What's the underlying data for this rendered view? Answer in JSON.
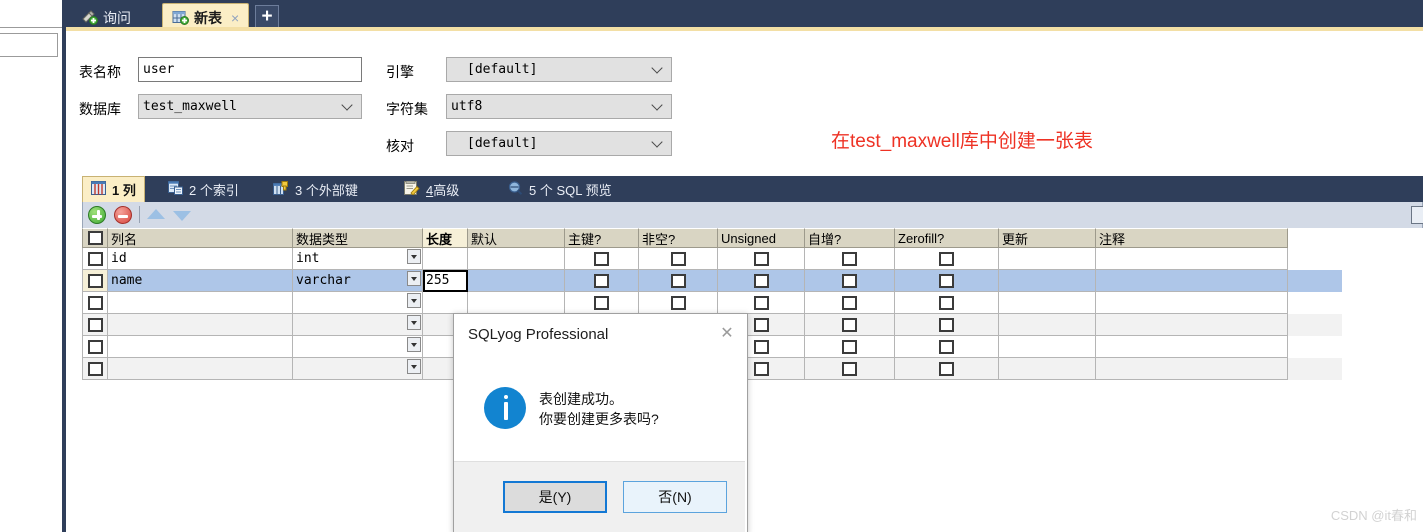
{
  "window": {
    "top_tabs": [
      {
        "label": "询问",
        "icon": "query-icon",
        "active": false,
        "closable": false
      },
      {
        "label": "新表",
        "icon": "new-table-icon",
        "active": true,
        "closable": true,
        "close_glyph": "×"
      }
    ],
    "add_tab_button": {
      "label": "+",
      "icon": "plus-icon"
    }
  },
  "form": {
    "table_name_label": "表名称",
    "table_name_value": "user",
    "database_label": "数据库",
    "database_value": "test_maxwell",
    "engine_label": "引擎",
    "engine_value": "[default]",
    "charset_label": "字符集",
    "charset_value": "utf8",
    "collation_label": "核对",
    "collation_value": "[default]"
  },
  "annotation": {
    "text": "在test_maxwell库中创建一张表",
    "color": "#ee3224"
  },
  "sub_tabs": [
    {
      "label": "1 列",
      "icon": "columns-icon",
      "active": true
    },
    {
      "label": "2 个索引",
      "icon": "index-icon",
      "active": false
    },
    {
      "label": "3 个外部键",
      "icon": "foreign-key-icon",
      "active": false
    },
    {
      "label": "4高级",
      "icon": "advanced-icon",
      "active": false,
      "underline_prefix": "4",
      "rest": "高级"
    },
    {
      "label": "5 个 SQL 预览",
      "icon": "sql-preview-icon",
      "active": false
    }
  ],
  "grid_toolbar": {
    "add_row": "add-row-icon",
    "remove_row": "remove-row-icon",
    "move_up": "move-up-icon",
    "move_down": "move-down-icon"
  },
  "grid": {
    "headers": [
      "",
      "列名",
      "数据类型",
      "长度",
      "默认",
      "主键?",
      "非空?",
      "Unsigned",
      "自增?",
      "Zerofill?",
      "更新",
      "注释"
    ],
    "highlighted_header": "长度",
    "rows": [
      {
        "selected": false,
        "alt": false,
        "name": "id",
        "type": "int",
        "length": "",
        "default": "",
        "has_type_dropdown": true,
        "length_focused": false
      },
      {
        "selected": true,
        "alt": false,
        "name": "name",
        "type": "varchar",
        "length": "255",
        "default": "",
        "has_type_dropdown": true,
        "length_focused": true
      },
      {
        "selected": false,
        "alt": false,
        "name": "",
        "type": "",
        "length": "",
        "default": "",
        "has_type_dropdown": true,
        "length_focused": false
      },
      {
        "selected": false,
        "alt": true,
        "name": "",
        "type": "",
        "length": "",
        "default": "",
        "has_type_dropdown": true,
        "length_focused": false
      },
      {
        "selected": false,
        "alt": false,
        "name": "",
        "type": "",
        "length": "",
        "default": "",
        "has_type_dropdown": true,
        "length_focused": false
      },
      {
        "selected": false,
        "alt": true,
        "name": "",
        "type": "",
        "length": "",
        "default": "",
        "has_type_dropdown": true,
        "length_focused": false
      }
    ]
  },
  "dialog": {
    "title": "SQLyog Professional",
    "close_glyph": "✕",
    "icon": "info-icon",
    "message_line1": "表创建成功。",
    "message_line2": "你要创建更多表吗?",
    "yes_button": "是(Y)",
    "no_button": "否(N)"
  },
  "watermark": "CSDN @it春和"
}
